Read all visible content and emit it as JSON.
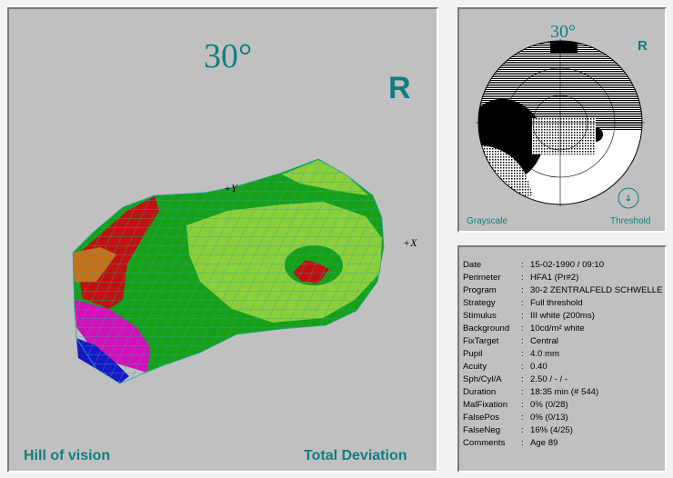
{
  "main": {
    "angle": "30°",
    "eye": "R",
    "axis_y": "+Y",
    "axis_x": "+X",
    "left_caption": "Hill of vision",
    "right_caption": "Total Deviation"
  },
  "thumbnail": {
    "angle": "30°",
    "eye": "R",
    "left_label": "Grayscale",
    "right_label": "Threshold"
  },
  "info": [
    {
      "key": "Date",
      "value": "15-02-1990 / 09:10"
    },
    {
      "key": "Perimeter",
      "value": "HFA1   (Pr#2)"
    },
    {
      "key": "Program",
      "value": "30-2 ZENTRALFELD SCHWELLE"
    },
    {
      "key": "Strategy",
      "value": "Full threshold"
    },
    {
      "key": "Stimulus",
      "value": "III  white (200ms)"
    },
    {
      "key": "Background",
      "value": "10cd/m²  white"
    },
    {
      "key": "FixTarget",
      "value": "Central"
    },
    {
      "key": "Pupil",
      "value": "  4.0 mm"
    },
    {
      "key": "Acuity",
      "value": "0.40"
    },
    {
      "key": "Sph/Cyl/A",
      "value": "2.50 / - / -"
    },
    {
      "key": "Duration",
      "value": "18:35 min  (# 544)"
    },
    {
      "key": "MalFixation",
      "value": "0% (0/28)"
    },
    {
      "key": "FalsePos",
      "value": "0% (0/13)"
    },
    {
      "key": "FalseNeg",
      "value": "16% (4/25)"
    },
    {
      "key": "Comments",
      "value": "Age  89"
    }
  ],
  "colors": {
    "teal": "#117f7f",
    "dark_green": "#17a017",
    "light_green": "#8ccf3a",
    "red": "#c01010",
    "orange": "#c87018",
    "magenta": "#d010b8",
    "blue": "#1818c8",
    "mesh": "#2aa6a6"
  }
}
